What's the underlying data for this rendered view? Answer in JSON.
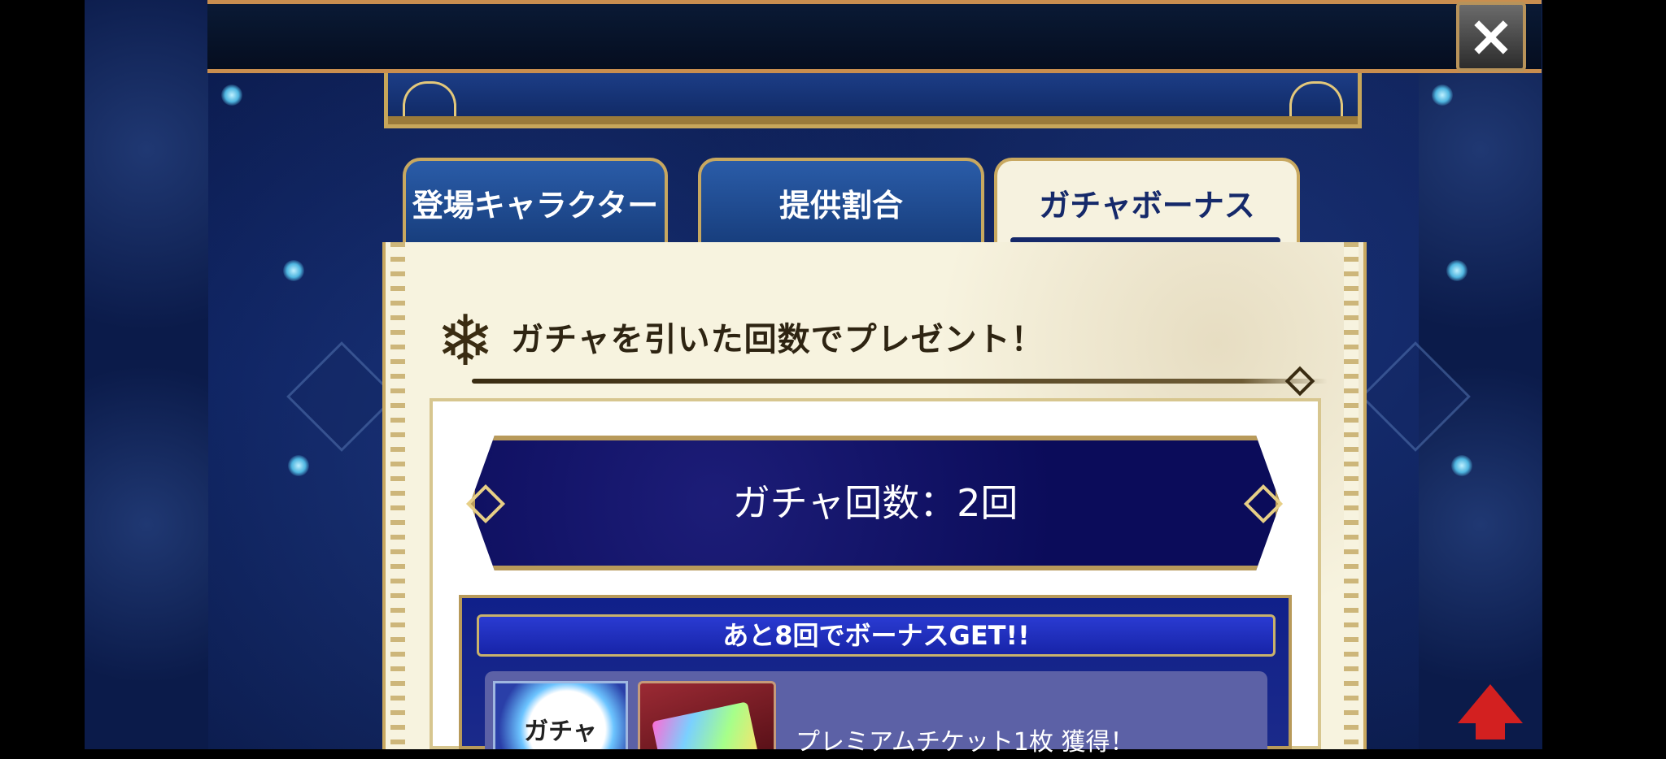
{
  "header": {
    "close_label": "×"
  },
  "tabs": [
    {
      "label": "登場キャラクター",
      "active": false
    },
    {
      "label": "提供割合",
      "active": false
    },
    {
      "label": "ガチャボーナス",
      "active": true
    }
  ],
  "section": {
    "title": "ガチャを引いた回数でプレゼント！"
  },
  "gacha_count": {
    "text": "ガチャ回数：2回"
  },
  "bonus": {
    "header": "あと8回でボーナスGET!!",
    "reward_icon_label": "ガチャ",
    "reward_text": "プレミアムチケット1枚 獲得！"
  },
  "colors": {
    "tab_active_text": "#15296a",
    "banner_bg": "#0b0c5a",
    "gold_border": "#c8a860"
  }
}
